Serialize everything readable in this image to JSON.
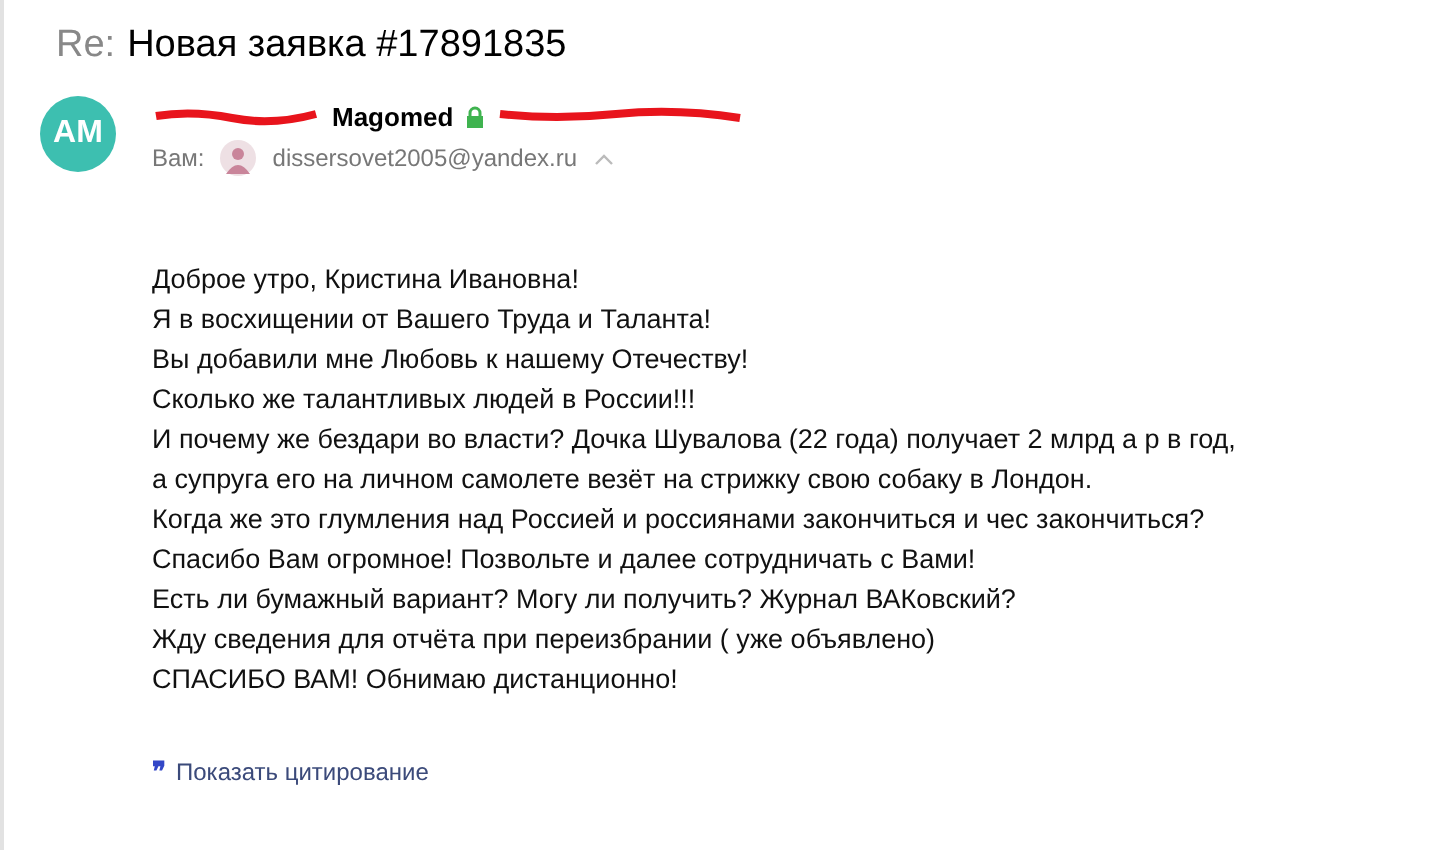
{
  "subject": {
    "prefix": "Re:",
    "title": "Новая заявка #17891835"
  },
  "sender": {
    "initials": "AM",
    "name": "Magomed",
    "to_label": "Вам:",
    "to_address": "dissersovet2005@yandex.ru"
  },
  "body": [
    "Доброе утро, Кристина Ивановна!",
    "Я в восхищении от Вашего Труда и Таланта!",
    "Вы добавили мне Любовь к нашему Отечеству!",
    "Сколько же талантливых людей в России!!!",
    "И почему же бездари во власти? Дочка Шувалова (22 года) получает 2 млрд а р в год,",
    "а супруга его на личном самолете везёт на стрижку свою собаку в Лондон.",
    "Когда же это глумления над Россией и россиянами закончиться и чес закончиться?",
    "Спасибо Вам огромное! Позвольте и далее сотрудничать с Вами!",
    "Есть ли бумажный вариант? Могу ли получить? Журнал ВАКовский?",
    "Жду сведения для отчёта при переизбрании ( уже объявлено)",
    "СПАСИБО ВАМ! Обнимаю дистанционно!"
  ],
  "quote_toggle": {
    "icon": "❞",
    "label": "Показать цитирование"
  }
}
